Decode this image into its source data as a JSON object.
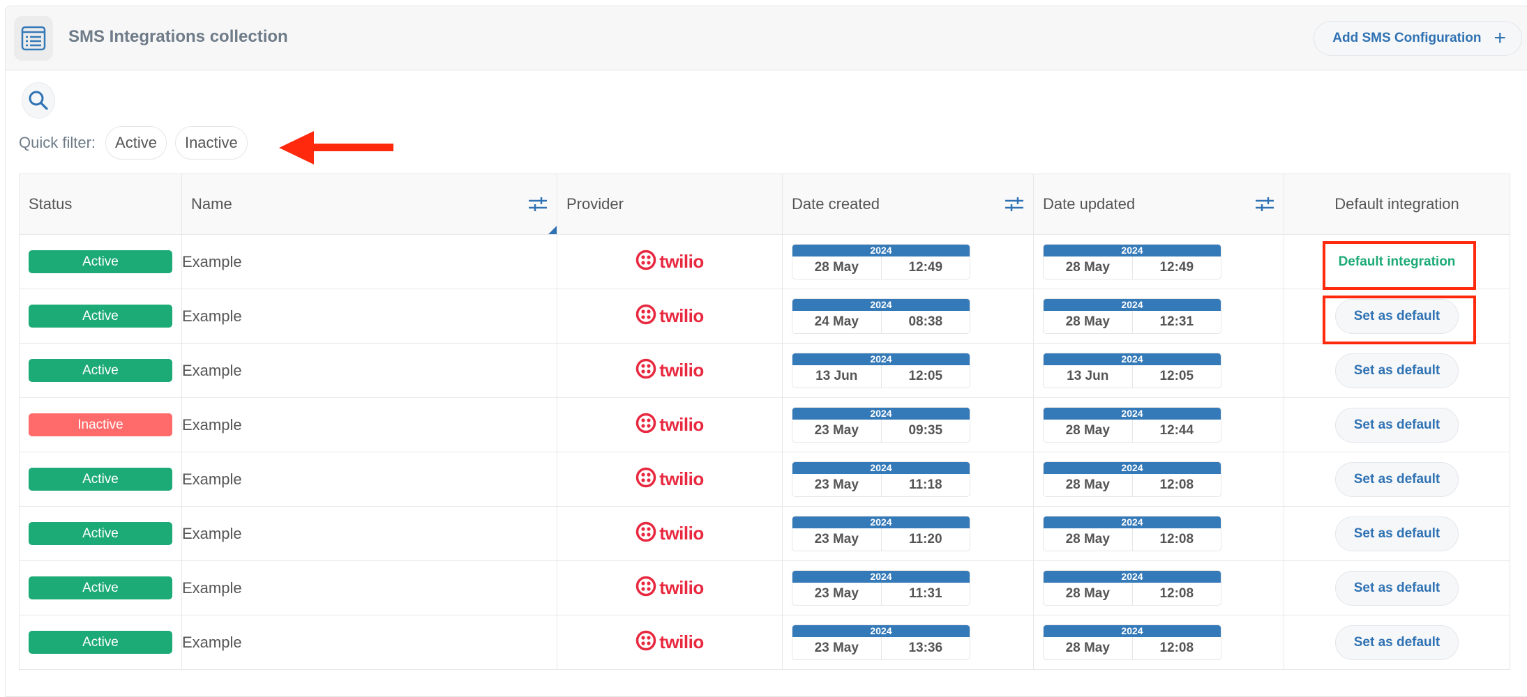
{
  "header": {
    "title": "SMS Integrations collection",
    "add_button_label": "Add SMS Configuration",
    "add_button_icon": "plus-icon",
    "collection_icon": "list-table-icon"
  },
  "search": {
    "icon": "search-icon"
  },
  "quick_filter": {
    "label": "Quick filter:",
    "options": [
      "Active",
      "Inactive"
    ]
  },
  "table": {
    "columns": [
      {
        "key": "status",
        "label": "Status"
      },
      {
        "key": "name",
        "label": "Name",
        "filter_icon": "sliders-icon"
      },
      {
        "key": "provider",
        "label": "Provider"
      },
      {
        "key": "date_created",
        "label": "Date created",
        "filter_icon": "sliders-icon"
      },
      {
        "key": "date_updated",
        "label": "Date updated",
        "filter_icon": "sliders-icon"
      },
      {
        "key": "default_integration",
        "label": "Default integration"
      }
    ],
    "rows": [
      {
        "status": "Active",
        "name": "Example",
        "provider": "twilio",
        "created": {
          "year": "2024",
          "day": "28 May",
          "time": "12:49"
        },
        "updated": {
          "year": "2024",
          "day": "28 May",
          "time": "12:49"
        },
        "default": {
          "is_default": true,
          "label": "Default integration"
        }
      },
      {
        "status": "Active",
        "name": "Example",
        "provider": "twilio",
        "created": {
          "year": "2024",
          "day": "24 May",
          "time": "08:38"
        },
        "updated": {
          "year": "2024",
          "day": "28 May",
          "time": "12:31"
        },
        "default": {
          "is_default": false,
          "label": "Set as default"
        }
      },
      {
        "status": "Active",
        "name": "Example",
        "provider": "twilio",
        "created": {
          "year": "2024",
          "day": "13 Jun",
          "time": "12:05"
        },
        "updated": {
          "year": "2024",
          "day": "13 Jun",
          "time": "12:05"
        },
        "default": {
          "is_default": false,
          "label": "Set as default"
        }
      },
      {
        "status": "Inactive",
        "name": "Example",
        "provider": "twilio",
        "created": {
          "year": "2024",
          "day": "23 May",
          "time": "09:35"
        },
        "updated": {
          "year": "2024",
          "day": "28 May",
          "time": "12:44"
        },
        "default": {
          "is_default": false,
          "label": "Set as default"
        }
      },
      {
        "status": "Active",
        "name": "Example",
        "provider": "twilio",
        "created": {
          "year": "2024",
          "day": "23 May",
          "time": "11:18"
        },
        "updated": {
          "year": "2024",
          "day": "28 May",
          "time": "12:08"
        },
        "default": {
          "is_default": false,
          "label": "Set as default"
        }
      },
      {
        "status": "Active",
        "name": "Example",
        "provider": "twilio",
        "created": {
          "year": "2024",
          "day": "23 May",
          "time": "11:20"
        },
        "updated": {
          "year": "2024",
          "day": "28 May",
          "time": "12:08"
        },
        "default": {
          "is_default": false,
          "label": "Set as default"
        }
      },
      {
        "status": "Active",
        "name": "Example",
        "provider": "twilio",
        "created": {
          "year": "2024",
          "day": "23 May",
          "time": "11:31"
        },
        "updated": {
          "year": "2024",
          "day": "28 May",
          "time": "12:08"
        },
        "default": {
          "is_default": false,
          "label": "Set as default"
        }
      },
      {
        "status": "Active",
        "name": "Example",
        "provider": "twilio",
        "created": {
          "year": "2024",
          "day": "23 May",
          "time": "13:36"
        },
        "updated": {
          "year": "2024",
          "day": "28 May",
          "time": "12:08"
        },
        "default": {
          "is_default": false,
          "label": "Set as default"
        }
      }
    ]
  },
  "colors": {
    "accent_blue": "#2f72b3",
    "date_header_blue": "#3479b8",
    "status_active": "#1caa76",
    "status_inactive": "#ff6b6b",
    "twilio_red": "#e8283f",
    "annotation_red": "#ff2a0e"
  },
  "annotations": [
    {
      "type": "arrow",
      "points_to": "quick-filter"
    },
    {
      "type": "box",
      "target": "row-1-default-integration"
    },
    {
      "type": "box",
      "target": "row-2-set-as-default"
    }
  ]
}
